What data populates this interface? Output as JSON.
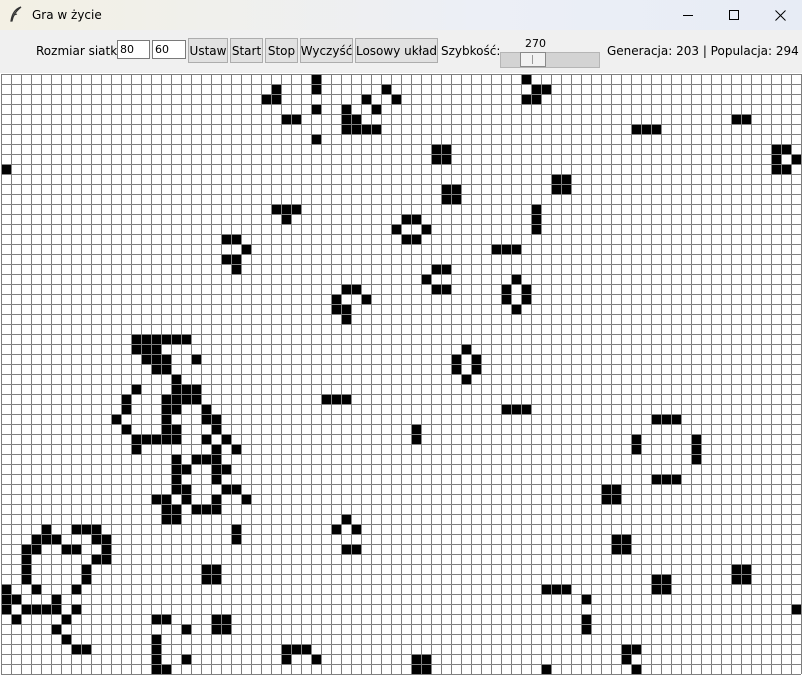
{
  "window": {
    "title": "Gra w życie"
  },
  "toolbar": {
    "grid_size_label": "Rozmiar siatki:",
    "width_value": "80",
    "height_value": "60",
    "set_button": "Ustaw",
    "start_button": "Start",
    "stop_button": "Stop",
    "clear_button": "Wyczyść",
    "random_button": "Losowy układ",
    "speed_label": "Szybkość:",
    "speed_value": "270",
    "speed_range": [
      10,
      1000
    ],
    "status": "Generacja: 203 | Populacja: 294"
  },
  "board": {
    "columns": 80,
    "rows": 60,
    "live_color": "#000000",
    "grid_color": "#808080",
    "dead_color": "#ffffff",
    "live_cells": [
      [
        31,
        0
      ],
      [
        52,
        0
      ],
      [
        27,
        1
      ],
      [
        31,
        1
      ],
      [
        38,
        1
      ],
      [
        53,
        1
      ],
      [
        54,
        1
      ],
      [
        26,
        2
      ],
      [
        27,
        2
      ],
      [
        36,
        2
      ],
      [
        39,
        2
      ],
      [
        52,
        2
      ],
      [
        53,
        2
      ],
      [
        31,
        3
      ],
      [
        34,
        3
      ],
      [
        37,
        3
      ],
      [
        28,
        4
      ],
      [
        29,
        4
      ],
      [
        34,
        4
      ],
      [
        35,
        4
      ],
      [
        73,
        4
      ],
      [
        74,
        4
      ],
      [
        34,
        5
      ],
      [
        35,
        5
      ],
      [
        36,
        5
      ],
      [
        37,
        5
      ],
      [
        63,
        5
      ],
      [
        64,
        5
      ],
      [
        65,
        5
      ],
      [
        31,
        6
      ],
      [
        77,
        7
      ],
      [
        78,
        7
      ],
      [
        43,
        7
      ],
      [
        44,
        7
      ],
      [
        77,
        8
      ],
      [
        79,
        8
      ],
      [
        43,
        8
      ],
      [
        44,
        8
      ],
      [
        77,
        9
      ],
      [
        78,
        9
      ],
      [
        0,
        9
      ],
      [
        55,
        10
      ],
      [
        56,
        10
      ],
      [
        44,
        11
      ],
      [
        45,
        11
      ],
      [
        55,
        11
      ],
      [
        56,
        11
      ],
      [
        44,
        12
      ],
      [
        45,
        12
      ],
      [
        27,
        13
      ],
      [
        28,
        13
      ],
      [
        29,
        13
      ],
      [
        53,
        13
      ],
      [
        40,
        14
      ],
      [
        41,
        14
      ],
      [
        53,
        14
      ],
      [
        28,
        14
      ],
      [
        39,
        15
      ],
      [
        42,
        15
      ],
      [
        53,
        15
      ],
      [
        22,
        16
      ],
      [
        23,
        16
      ],
      [
        40,
        16
      ],
      [
        41,
        16
      ],
      [
        24,
        17
      ],
      [
        49,
        17
      ],
      [
        50,
        17
      ],
      [
        51,
        17
      ],
      [
        22,
        18
      ],
      [
        23,
        18
      ],
      [
        23,
        19
      ],
      [
        43,
        19
      ],
      [
        44,
        19
      ],
      [
        42,
        20
      ],
      [
        51,
        20
      ],
      [
        34,
        21
      ],
      [
        35,
        21
      ],
      [
        43,
        21
      ],
      [
        44,
        21
      ],
      [
        50,
        21
      ],
      [
        52,
        21
      ],
      [
        33,
        22
      ],
      [
        36,
        22
      ],
      [
        50,
        22
      ],
      [
        52,
        22
      ],
      [
        33,
        23
      ],
      [
        34,
        23
      ],
      [
        51,
        23
      ],
      [
        34,
        24
      ],
      [
        13,
        26
      ],
      [
        14,
        26
      ],
      [
        15,
        26
      ],
      [
        16,
        26
      ],
      [
        17,
        26
      ],
      [
        18,
        26
      ],
      [
        13,
        27
      ],
      [
        14,
        27
      ],
      [
        15,
        27
      ],
      [
        46,
        27
      ],
      [
        14,
        28
      ],
      [
        15,
        28
      ],
      [
        16,
        28
      ],
      [
        19,
        28
      ],
      [
        45,
        28
      ],
      [
        47,
        28
      ],
      [
        15,
        29
      ],
      [
        16,
        29
      ],
      [
        45,
        29
      ],
      [
        47,
        29
      ],
      [
        17,
        30
      ],
      [
        46,
        30
      ],
      [
        13,
        31
      ],
      [
        17,
        31
      ],
      [
        18,
        31
      ],
      [
        19,
        31
      ],
      [
        12,
        32
      ],
      [
        16,
        32
      ],
      [
        17,
        32
      ],
      [
        18,
        32
      ],
      [
        19,
        32
      ],
      [
        32,
        32
      ],
      [
        33,
        32
      ],
      [
        34,
        32
      ],
      [
        12,
        33
      ],
      [
        16,
        33
      ],
      [
        17,
        33
      ],
      [
        20,
        33
      ],
      [
        50,
        33
      ],
      [
        51,
        33
      ],
      [
        52,
        33
      ],
      [
        11,
        34
      ],
      [
        16,
        34
      ],
      [
        20,
        34
      ],
      [
        21,
        34
      ],
      [
        65,
        34
      ],
      [
        66,
        34
      ],
      [
        67,
        34
      ],
      [
        12,
        35
      ],
      [
        16,
        35
      ],
      [
        17,
        35
      ],
      [
        21,
        35
      ],
      [
        41,
        35
      ],
      [
        13,
        36
      ],
      [
        14,
        36
      ],
      [
        15,
        36
      ],
      [
        16,
        36
      ],
      [
        17,
        36
      ],
      [
        20,
        36
      ],
      [
        22,
        36
      ],
      [
        41,
        36
      ],
      [
        63,
        36
      ],
      [
        69,
        36
      ],
      [
        13,
        37
      ],
      [
        21,
        37
      ],
      [
        23,
        37
      ],
      [
        63,
        37
      ],
      [
        69,
        37
      ],
      [
        17,
        38
      ],
      [
        19,
        38
      ],
      [
        20,
        38
      ],
      [
        21,
        38
      ],
      [
        69,
        38
      ],
      [
        17,
        39
      ],
      [
        18,
        39
      ],
      [
        21,
        39
      ],
      [
        22,
        39
      ],
      [
        17,
        40
      ],
      [
        21,
        40
      ],
      [
        65,
        40
      ],
      [
        66,
        40
      ],
      [
        67,
        40
      ],
      [
        17,
        41
      ],
      [
        18,
        41
      ],
      [
        22,
        41
      ],
      [
        23,
        41
      ],
      [
        60,
        41
      ],
      [
        61,
        41
      ],
      [
        15,
        42
      ],
      [
        16,
        42
      ],
      [
        18,
        42
      ],
      [
        21,
        42
      ],
      [
        24,
        42
      ],
      [
        60,
        42
      ],
      [
        61,
        42
      ],
      [
        16,
        43
      ],
      [
        17,
        43
      ],
      [
        19,
        43
      ],
      [
        20,
        43
      ],
      [
        21,
        43
      ],
      [
        16,
        44
      ],
      [
        17,
        44
      ],
      [
        34,
        44
      ],
      [
        4,
        45
      ],
      [
        7,
        45
      ],
      [
        8,
        45
      ],
      [
        9,
        45
      ],
      [
        23,
        45
      ],
      [
        33,
        45
      ],
      [
        35,
        45
      ],
      [
        3,
        46
      ],
      [
        4,
        46
      ],
      [
        5,
        46
      ],
      [
        9,
        46
      ],
      [
        10,
        46
      ],
      [
        23,
        46
      ],
      [
        61,
        46
      ],
      [
        62,
        46
      ],
      [
        2,
        47
      ],
      [
        3,
        47
      ],
      [
        6,
        47
      ],
      [
        7,
        47
      ],
      [
        10,
        47
      ],
      [
        34,
        47
      ],
      [
        35,
        47
      ],
      [
        61,
        47
      ],
      [
        62,
        47
      ],
      [
        2,
        48
      ],
      [
        9,
        48
      ],
      [
        10,
        48
      ],
      [
        2,
        49
      ],
      [
        8,
        49
      ],
      [
        20,
        49
      ],
      [
        21,
        49
      ],
      [
        73,
        49
      ],
      [
        74,
        49
      ],
      [
        2,
        50
      ],
      [
        8,
        50
      ],
      [
        20,
        50
      ],
      [
        21,
        50
      ],
      [
        65,
        50
      ],
      [
        66,
        50
      ],
      [
        73,
        50
      ],
      [
        74,
        50
      ],
      [
        0,
        51
      ],
      [
        3,
        51
      ],
      [
        7,
        51
      ],
      [
        54,
        51
      ],
      [
        55,
        51
      ],
      [
        56,
        51
      ],
      [
        65,
        51
      ],
      [
        66,
        51
      ],
      [
        0,
        52
      ],
      [
        1,
        52
      ],
      [
        5,
        52
      ],
      [
        58,
        52
      ],
      [
        0,
        53
      ],
      [
        2,
        53
      ],
      [
        3,
        53
      ],
      [
        4,
        53
      ],
      [
        5,
        53
      ],
      [
        7,
        53
      ],
      [
        79,
        53
      ],
      [
        1,
        54
      ],
      [
        6,
        54
      ],
      [
        15,
        54
      ],
      [
        16,
        54
      ],
      [
        21,
        54
      ],
      [
        22,
        54
      ],
      [
        58,
        54
      ],
      [
        5,
        55
      ],
      [
        18,
        55
      ],
      [
        21,
        55
      ],
      [
        22,
        55
      ],
      [
        58,
        55
      ],
      [
        6,
        56
      ],
      [
        15,
        56
      ],
      [
        7,
        57
      ],
      [
        8,
        57
      ],
      [
        15,
        57
      ],
      [
        28,
        57
      ],
      [
        29,
        57
      ],
      [
        30,
        57
      ],
      [
        62,
        57
      ],
      [
        63,
        57
      ],
      [
        15,
        58
      ],
      [
        18,
        58
      ],
      [
        28,
        58
      ],
      [
        31,
        58
      ],
      [
        41,
        58
      ],
      [
        42,
        58
      ],
      [
        62,
        58
      ],
      [
        15,
        59
      ],
      [
        16,
        59
      ],
      [
        41,
        59
      ],
      [
        42,
        59
      ],
      [
        54,
        59
      ],
      [
        63,
        59
      ]
    ]
  }
}
